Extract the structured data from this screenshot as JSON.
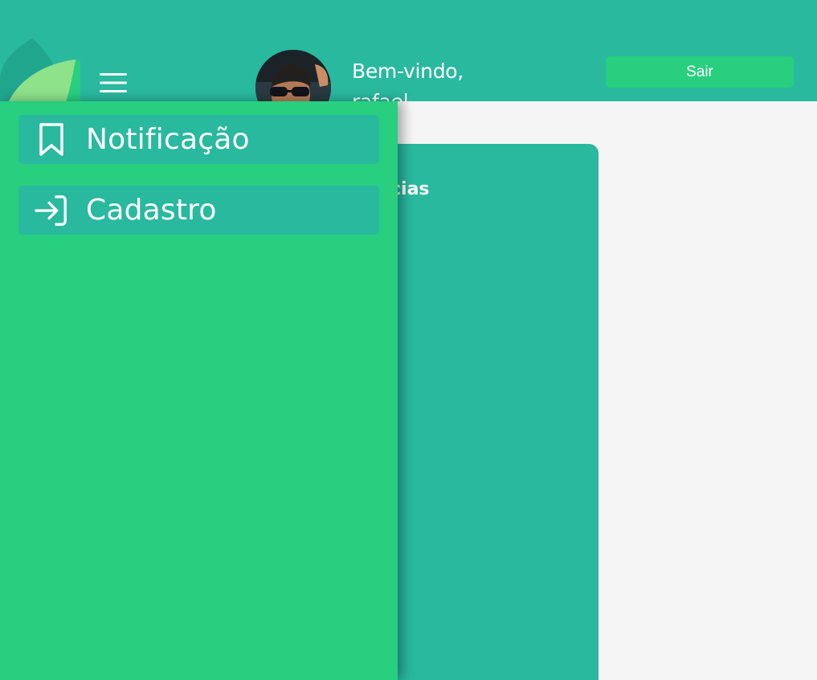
{
  "colors": {
    "header_bg": "#29b99f",
    "drawer_bg": "#27cf7e",
    "drawer_item_bg": "#29b99f",
    "logout_button_bg": "#27cf7e",
    "content_bg": "#f5f5f5",
    "card_bg": "#29b99f",
    "text_light": "#ffffff"
  },
  "header": {
    "logo_icon": "leaf-logo-icon",
    "menu_icon": "hamburger-menu-icon",
    "welcome_text": "Bem-vindo,",
    "user_name": "rafael",
    "logout_label": "Sair"
  },
  "main": {
    "card_title": "cias"
  },
  "drawer": {
    "items": [
      {
        "label": "Notificação",
        "icon": "bookmark-icon"
      },
      {
        "label": "Cadastro",
        "icon": "sign-in-icon"
      }
    ]
  }
}
